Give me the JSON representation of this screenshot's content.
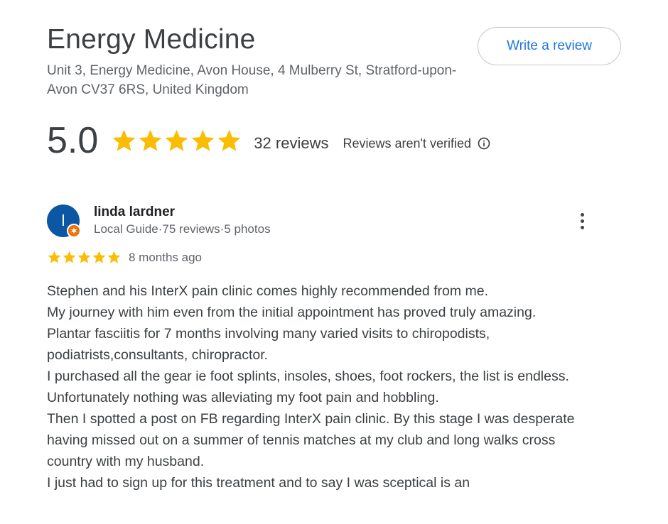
{
  "business": {
    "name": "Energy Medicine",
    "address": "Unit 3, Energy Medicine, Avon House, 4 Mulberry St, Stratford-upon-Avon CV37 6RS, United Kingdom"
  },
  "actions": {
    "write_review_label": "Write a review"
  },
  "summary": {
    "rating": "5.0",
    "star_count": 5,
    "review_count": "32 reviews",
    "verification_note": "Reviews aren't verified"
  },
  "review": {
    "avatar_letter": "l",
    "reviewer_name": "linda lardner",
    "local_guide": "Local Guide",
    "reviews_count": "75 reviews",
    "photos_count": "5 photos",
    "separator": " · ",
    "stars": 5,
    "date": "8 months ago",
    "text_lines": [
      "Stephen and his InterX pain clinic comes highly recommended from me.",
      "My journey with him even from the initial appointment has proved truly amazing.",
      "Plantar fasciitis for 7 months involving many varied visits to chiropodists, podiatrists,consultants, chiropractor.",
      "I purchased all the gear ie foot splints, insoles, shoes, foot rockers, the list is endless.",
      "Unfortunately nothing was alleviating my foot pain and hobbling.",
      "Then I spotted a post on FB regarding InterX pain clinic. By this stage I was desperate having missed out on a summer of tennis matches at my club and long walks cross country with my husband.",
      "I just had to sign up for this treatment and to say I was sceptical is an"
    ]
  },
  "colors": {
    "star": "#fbbc04",
    "link": "#1a73e8",
    "avatar": "#0b57a4",
    "guide_badge": "#e8710a"
  },
  "icons": {
    "star": "star-icon",
    "info": "info-icon",
    "more": "more-vert-icon",
    "guide": "local-guide-badge-icon"
  }
}
